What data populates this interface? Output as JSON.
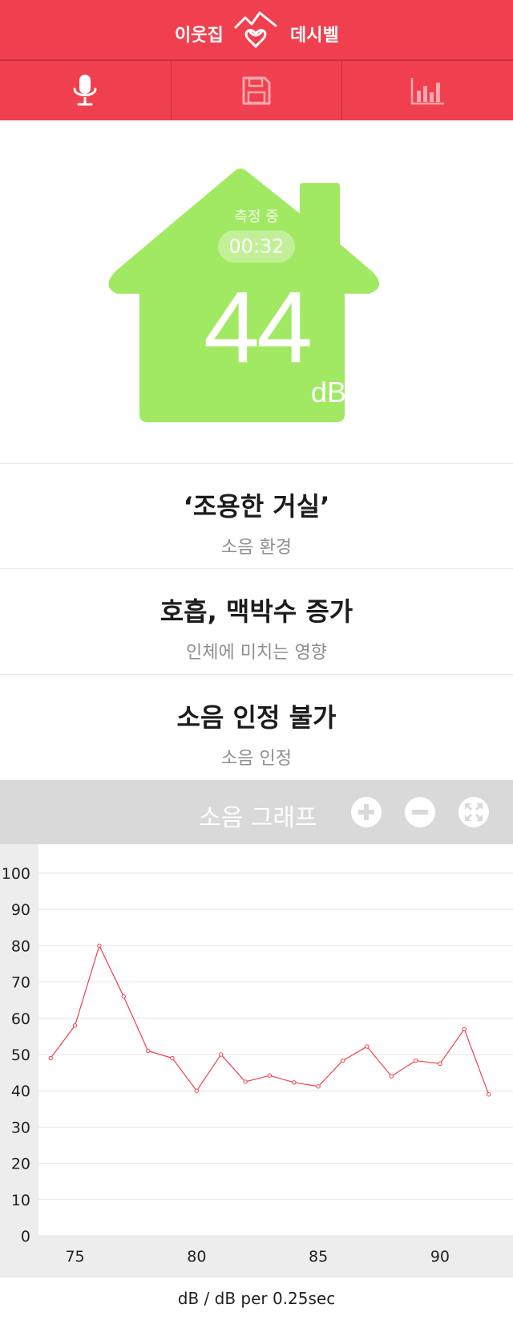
{
  "header": {
    "brand_left": "이웃집",
    "brand_right": "데시벨",
    "logo_icon": "house-heart-logo-icon"
  },
  "toolbar": {
    "items": [
      {
        "icon": "microphone-icon",
        "active": true
      },
      {
        "icon": "save-icon",
        "active": false
      },
      {
        "icon": "bar-chart-icon",
        "active": false
      }
    ]
  },
  "meter": {
    "status": "측정 중",
    "timer": "00:32",
    "value": "44",
    "unit": "dB",
    "house_color": "#a1e962"
  },
  "info": [
    {
      "main": "‘조용한 거실’",
      "sub": "소음 환경"
    },
    {
      "main": "호흡, 맥박수 증가",
      "sub": "인체에 미치는 영향"
    },
    {
      "main": "소음 인정 불가",
      "sub": "소음 인정"
    }
  ],
  "graph": {
    "title": "소음 그래프",
    "buttons": [
      "plus-icon",
      "minus-icon",
      "fullscreen-icon"
    ]
  },
  "chart_data": {
    "type": "line",
    "x": [
      74,
      75,
      76,
      77,
      78,
      79,
      80,
      81,
      82,
      83,
      84,
      85,
      86,
      87,
      88,
      89,
      90,
      91,
      92
    ],
    "series": [
      {
        "values": [
          49,
          58,
          80,
          66,
          51,
          49,
          40,
          50,
          42.5,
          44.2,
          42.3,
          41.2,
          48.3,
          52.2,
          44,
          48.3,
          47.5,
          57,
          39
        ]
      }
    ],
    "ylim": [
      0,
      100
    ],
    "yticks": [
      "0",
      "10",
      "20",
      "30",
      "40",
      "50",
      "60",
      "70",
      "80",
      "90",
      "100"
    ],
    "xticks": [
      "75",
      "80",
      "85",
      "90"
    ],
    "xtick_values": [
      75,
      80,
      85,
      90
    ],
    "xlim": [
      73.5,
      93
    ],
    "line_color": "#f0404f",
    "grid": true,
    "footer_label": "dB / dB per 0.25sec"
  }
}
